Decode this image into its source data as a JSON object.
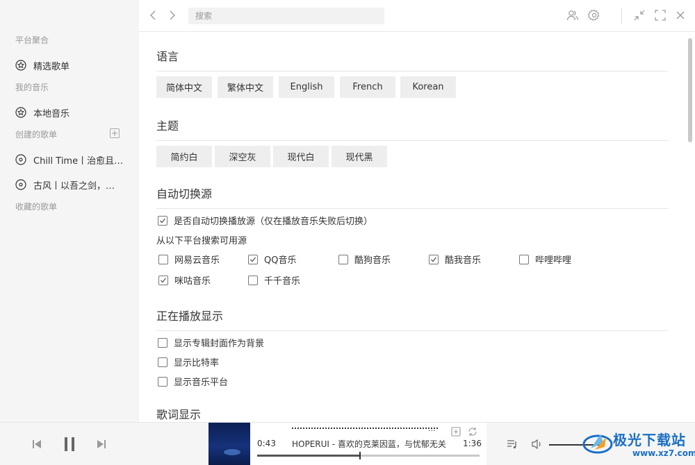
{
  "sidebar": {
    "sections": {
      "platform": "平台聚合",
      "my_music": "我的音乐",
      "created": "创建的歌单",
      "collected": "收藏的歌单"
    },
    "items": {
      "featured": "精选歌单",
      "local": "本地音乐",
      "playlist1": "Chill Time丨治愈且温柔的旋律",
      "playlist2": "古风丨以吾之剑，斩你心头雪"
    }
  },
  "topbar": {
    "search_placeholder": "搜索",
    "icons": [
      "chevron-left-icon",
      "chevron-right-icon",
      "user-icon",
      "gear-icon",
      "minimize-icon",
      "fullscreen-icon",
      "close-icon"
    ]
  },
  "settings": {
    "language": {
      "title": "语言",
      "options": [
        "简体中文",
        "繁体中文",
        "English",
        "French",
        "Korean"
      ]
    },
    "theme": {
      "title": "主题",
      "options": [
        "简约白",
        "深空灰",
        "现代白",
        "现代黑"
      ]
    },
    "auto_switch": {
      "title": "自动切换源",
      "toggle_label": "是否自动切换播放源（仅在播放音乐失败后切换）",
      "toggle_checked": true,
      "sources_label": "从以下平台搜索可用源",
      "sources": [
        {
          "label": "网易云音乐",
          "checked": false
        },
        {
          "label": "QQ音乐",
          "checked": true
        },
        {
          "label": "酷狗音乐",
          "checked": false
        },
        {
          "label": "酷我音乐",
          "checked": true
        },
        {
          "label": "哔哩哔哩",
          "checked": false
        },
        {
          "label": "咪咕音乐",
          "checked": true
        },
        {
          "label": "千千音乐",
          "checked": false
        }
      ]
    },
    "now_playing": {
      "title": "正在播放显示",
      "options": [
        {
          "label": "显示专辑封面作为背景",
          "checked": false
        },
        {
          "label": "显示比特率",
          "checked": false
        },
        {
          "label": "显示音乐平台",
          "checked": false
        }
      ]
    },
    "lyrics": {
      "title": "歌词显示"
    }
  },
  "player": {
    "current_time": "0:43",
    "total_time": "1:36",
    "song_title": "HOPERUI - 喜欢的克莱因蓝，与忧郁无关",
    "lyric_ellipsis": "...",
    "progress": 0.46
  },
  "watermark": {
    "name": "极光下载站",
    "url": "www.xz7.com"
  }
}
